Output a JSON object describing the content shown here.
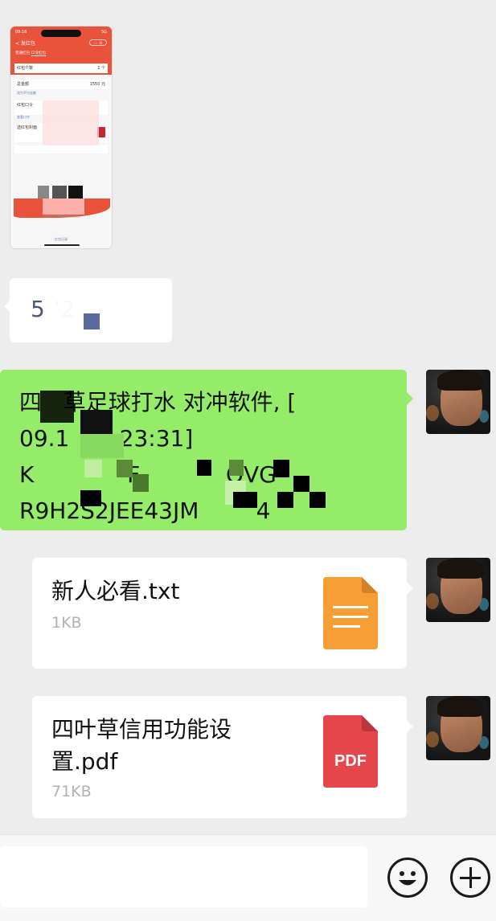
{
  "thumbnail": {
    "clock": "09:16",
    "status": "5G",
    "back": "< 发红包",
    "capsule": "··· ⊙",
    "tabs": [
      "普通红包",
      "口令红包"
    ],
    "count_label": "红包个数",
    "count_value": "1 个",
    "total_label": "总金额",
    "total_value": "1550 元",
    "avg_link": "改为平均金额",
    "command_label": "红包口令",
    "command_link": "查看口令",
    "cover_label": "选红包封面",
    "tip": "24小时内未被领取将退回",
    "footer_link": "红包记录"
  },
  "short_message": {
    "text": "5         '2"
  },
  "code_message": {
    "text": "四   草足球打水 对冲软件, [\n09.1       23:31]\nK             F            QVG\nR9H2S2JEE43JM        4"
  },
  "file_txt": {
    "name": "新人必看.txt",
    "size": "1KB",
    "icon_color": "#f79f35"
  },
  "file_pdf": {
    "name": "四叶草信用功能设置.pdf",
    "size": "71KB",
    "icon_label": "PDF",
    "icon_color": "#e5474b"
  },
  "input_bar": {
    "placeholder": ""
  },
  "colors": {
    "chat_bg": "#ededed",
    "sent_bubble": "#95ec69",
    "received_bubble": "#ffffff",
    "thumb_header": "#e9533b"
  }
}
